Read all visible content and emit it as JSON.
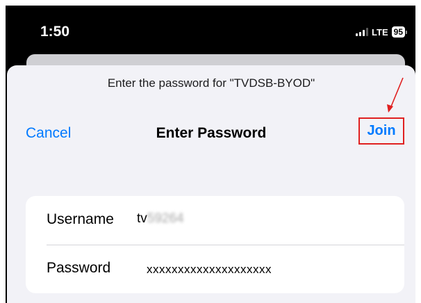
{
  "status_bar": {
    "time": "1:50",
    "network": "LTE",
    "battery": "95"
  },
  "dialog": {
    "prompt": "Enter the password for \"TVDSB-BYOD\"",
    "title": "Enter Password",
    "cancel_label": "Cancel",
    "join_label": "Join"
  },
  "form": {
    "username_label": "Username",
    "username_visible": "tv",
    "username_blurred": "59264",
    "password_label": "Password",
    "password_value": "xxxxxxxxxxxxxxxxxxxx"
  },
  "colors": {
    "accent": "#007aff",
    "annotation": "#e02020",
    "sheet_background": "#f2f2f7"
  }
}
